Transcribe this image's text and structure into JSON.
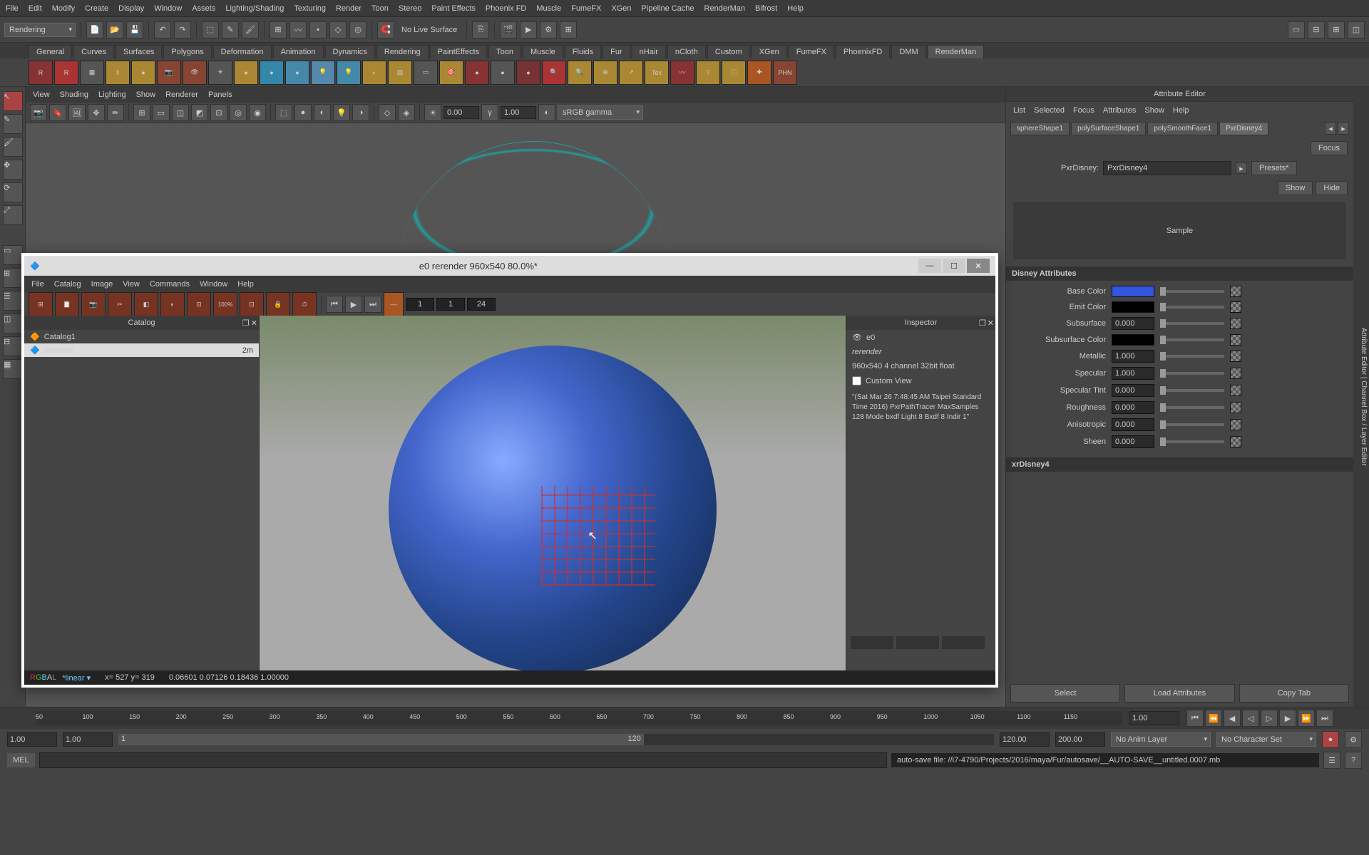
{
  "menubar": [
    "File",
    "Edit",
    "Modify",
    "Create",
    "Display",
    "Window",
    "Assets",
    "Lighting/Shading",
    "Texturing",
    "Render",
    "Toon",
    "Stereo",
    "Paint Effects",
    "Phoenix FD",
    "Muscle",
    "FumeFX",
    "XGen",
    "Pipeline Cache",
    "RenderMan",
    "Bifrost",
    "Help"
  ],
  "workspace_dropdown": "Rendering",
  "no_live_surface": "No Live Surface",
  "shelf_tabs": [
    "General",
    "Curves",
    "Surfaces",
    "Polygons",
    "Deformation",
    "Animation",
    "Dynamics",
    "Rendering",
    "PaintEffects",
    "Toon",
    "Muscle",
    "Fluids",
    "Fur",
    "nHair",
    "nCloth",
    "Custom",
    "XGen",
    "FumeFX",
    "PhoenixFD",
    "DMM",
    "RenderMan"
  ],
  "shelf_active": "RenderMan",
  "viewport_menus": [
    "View",
    "Shading",
    "Lighting",
    "Show",
    "Renderer",
    "Panels"
  ],
  "vp_val1": "0.00",
  "vp_val2": "1.00",
  "vp_colorspace": "sRGB gamma",
  "attr_editor": {
    "title": "Attribute Editor",
    "menus": [
      "List",
      "Selected",
      "Focus",
      "Attributes",
      "Show",
      "Help"
    ],
    "tabs": [
      "sphereShape1",
      "polySurfaceShape1",
      "polySmoothFace1",
      "PxrDisney4"
    ],
    "active_tab": "PxrDisney4",
    "focus_btn": "Focus",
    "presets_btn": "Presets*",
    "show_btn": "Show",
    "hide_btn": "Hide",
    "node_type": "PxrDisney:",
    "node_name": "PxrDisney4",
    "sample": "Sample",
    "section": "Disney Attributes",
    "params": [
      {
        "label": "Base Color",
        "type": "color",
        "color": "#3355dd"
      },
      {
        "label": "Emit Color",
        "type": "color",
        "color": "#000000"
      },
      {
        "label": "Subsurface",
        "type": "num",
        "value": "0.000"
      },
      {
        "label": "Subsurface Color",
        "type": "color",
        "color": "#000000"
      },
      {
        "label": "Metallic",
        "type": "num",
        "value": "1.000"
      },
      {
        "label": "Specular",
        "type": "num",
        "value": "1.000"
      },
      {
        "label": "Specular Tint",
        "type": "num",
        "value": "0.000"
      },
      {
        "label": "Roughness",
        "type": "num",
        "value": "0.000"
      },
      {
        "label": "Anisotropic",
        "type": "num",
        "value": "0.000"
      },
      {
        "label": "Sheen",
        "type": "num",
        "value": "0.000"
      }
    ],
    "footer_node": "xrDisney4",
    "btn_select": "Select",
    "btn_load": "Load Attributes",
    "btn_copy": "Copy Tab"
  },
  "side_tab": "Attribute Editor | Channel Box / Layer Editor",
  "timeline": {
    "ticks": [
      "50",
      "100",
      "150",
      "200",
      "250",
      "300",
      "350",
      "400",
      "450",
      "500",
      "550",
      "600",
      "650",
      "700",
      "750",
      "800",
      "850",
      "900",
      "950",
      "1000",
      "1050",
      "1100",
      "1150"
    ],
    "cur": "1.00",
    "start": "1.00",
    "range_start": "1",
    "range_end": "120",
    "end": "120.00",
    "total": "200.00",
    "anim_layer": "No Anim Layer",
    "char_set": "No Character Set"
  },
  "cmd_label": "MEL",
  "status": "auto-save file: //i7-4790/Projects/2016/maya/Fur/autosave/__AUTO-SAVE__untitled.0007.mb",
  "float_win": {
    "title": "e0 rerender 960x540 80.0%*",
    "menus": [
      "File",
      "Catalog",
      "Image",
      "View",
      "Commands",
      "Window",
      "Help"
    ],
    "frame_a": "1",
    "frame_b": "1",
    "frame_c": "24",
    "catalog_title": "Catalog",
    "inspector_title": "Inspector",
    "catalog_root": "Catalog1",
    "catalog_item": "rerender",
    "catalog_time": "2m",
    "insp_name": "e0",
    "insp_sub": "rerender",
    "insp_res": "960x540 4 channel 32bit float",
    "insp_custom": "Custom View",
    "insp_info": "\"(Sat Mar 26 7:48:45 AM Taipei Standard Time 2016) PxrPathTracer MaxSamples 128 Mode bxdf Light 8 Bxdf 8 Indir 1\"",
    "status_linear": "*linear ▾",
    "status_xy": "x= 527    y= 319",
    "status_rgba": "0.06601 0.07126 0.18436 1.00000"
  }
}
